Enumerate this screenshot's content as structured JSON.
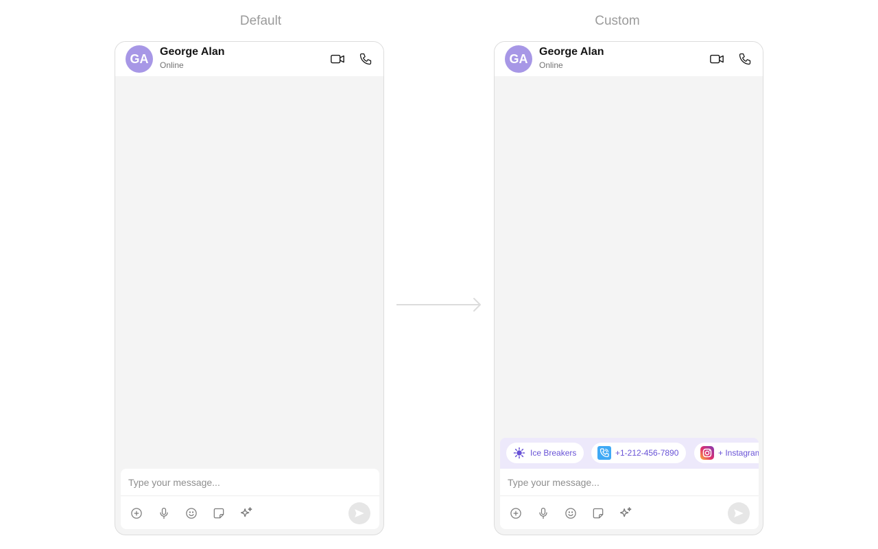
{
  "labels": {
    "default": "Default",
    "custom": "Custom"
  },
  "header": {
    "avatar_initials": "GA",
    "name": "George Alan",
    "status": "Online"
  },
  "composer": {
    "placeholder": "Type your message..."
  },
  "custom_chips": [
    {
      "label": "Ice Breakers",
      "icon": "sun-icon"
    },
    {
      "label": "+1-212-456-7890",
      "icon": "viber-phone-icon"
    },
    {
      "label": "+ Instagram",
      "icon": "instagram-icon"
    }
  ],
  "colors": {
    "avatar": "#a797e6",
    "accent": "#6852d6",
    "chip_bar": "#ede9fb",
    "background": "#f4f4f4"
  },
  "icons": {
    "header": [
      "video-call-icon",
      "phone-call-icon"
    ],
    "composer_tools": [
      "add-circle-icon",
      "microphone-icon",
      "emoji-icon",
      "sticker-icon",
      "ai-sparkle-icon"
    ],
    "send": "send-icon"
  }
}
